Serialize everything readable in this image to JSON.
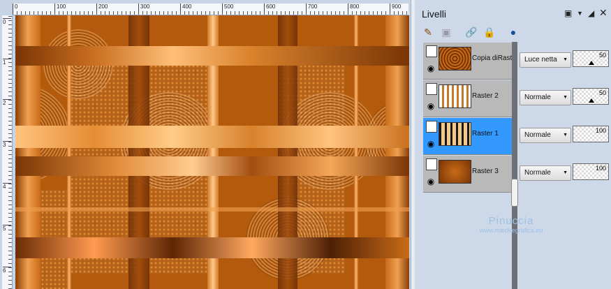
{
  "rulers": {
    "top": [
      "0",
      "100",
      "200",
      "300",
      "400",
      "500",
      "600",
      "700",
      "800",
      "900"
    ],
    "left": [
      "0",
      "1",
      "2",
      "3",
      "4",
      "5",
      "6"
    ]
  },
  "panel": {
    "title": "Livelli",
    "header_icons": [
      "restore-icon",
      "dropdown-icon",
      "pin-icon",
      "close-icon"
    ],
    "toolbar_icons": [
      "new-raster-layer-icon",
      "new-mask-layer-icon",
      "link-icon",
      "lock-icon",
      "mask-icon"
    ]
  },
  "layers": [
    {
      "name": "Copia diRaste",
      "blend": "Luce netta",
      "opacity": "50",
      "selected": false,
      "thumb_color": "#a8500e"
    },
    {
      "name": "Raster 2",
      "blend": "Normale",
      "opacity": "50",
      "selected": false,
      "thumb_color": "#ffffff"
    },
    {
      "name": "Raster 1",
      "blend": "Normale",
      "opacity": "100",
      "selected": true,
      "thumb_color": "#1a1a1a"
    },
    {
      "name": "Raster 3",
      "blend": "Normale",
      "opacity": "100",
      "selected": false,
      "thumb_color": "#9c4a0e"
    }
  ],
  "watermark": {
    "name": "Pinuccia",
    "url": "www.maidiregrafica.eu"
  },
  "colors": {
    "accent": "#3399ff",
    "canvas_base": "#b35a0c"
  }
}
